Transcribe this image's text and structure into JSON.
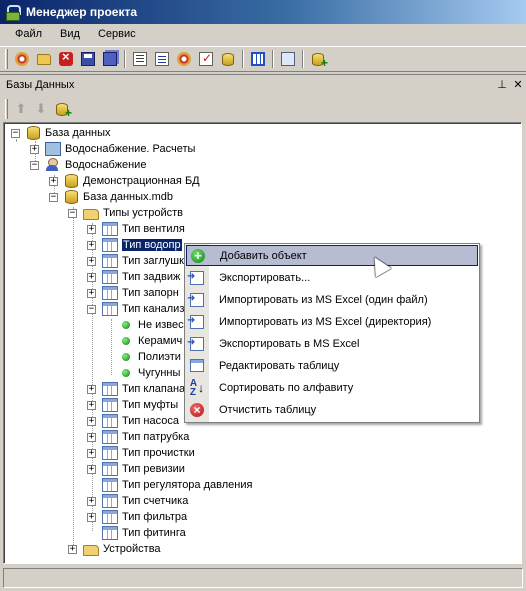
{
  "window": {
    "title": "Менеджер проекта"
  },
  "menu": {
    "items": [
      "Файл",
      "Вид",
      "Сервис"
    ]
  },
  "panel": {
    "title": "Базы Данных",
    "pin_icon": "pin-icon",
    "close_icon": "close-icon"
  },
  "tree": {
    "root": "База данных",
    "vodosnab_raschety": "Водоснабжение. Расчеты",
    "vodosnab": "Водоснабжение",
    "demo_db": "Демонстрационная БД",
    "db_mdb": "База данных.mdb",
    "device_types": "Типы устройств",
    "types": [
      "Тип вентиля",
      "Тип водопр",
      "Тип заглушк",
      "Тип задвиж",
      "Тип запорн",
      "Тип канализ"
    ],
    "kanal_children": [
      "Не извес",
      "Керамич",
      "Полиэти",
      "Чугунны"
    ],
    "types_after": [
      "Тип клапана",
      "Тип муфты",
      "Тип насоса",
      "Тип патрубка",
      "Тип прочистки",
      "Тип ревизии",
      "Тип регулятора давления",
      "Тип счетчика",
      "Тип фильтра",
      "Тип фитинга"
    ],
    "devices": "Устройства"
  },
  "context_menu": {
    "items": [
      {
        "label": "Добавить объект",
        "icon": "add-icon"
      },
      {
        "label": "Экспортировать...",
        "icon": "export-icon"
      },
      {
        "label": "Импортировать из MS Excel (один файл)",
        "icon": "import-file-icon"
      },
      {
        "label": "Импортировать из MS Excel (директория)",
        "icon": "import-folder-icon"
      },
      {
        "label": "Экспортировать в MS Excel",
        "icon": "export-excel-icon"
      },
      {
        "label": "Редактировать таблицу",
        "icon": "table-icon"
      },
      {
        "label": "Сортировать по алфавиту",
        "icon": "sort-az-icon"
      },
      {
        "label": "Отчистить таблицу",
        "icon": "clear-icon"
      }
    ]
  }
}
